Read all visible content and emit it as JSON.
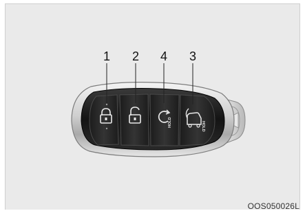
{
  "figure": {
    "image_code": "OOS050026L",
    "background_color": "#eaeaea"
  },
  "callouts": [
    {
      "label": "1",
      "button": "lock"
    },
    {
      "label": "2",
      "button": "unlock"
    },
    {
      "label": "4",
      "button": "remote-start"
    },
    {
      "label": "3",
      "button": "liftgate"
    }
  ],
  "fob_buttons": [
    {
      "function": "lock",
      "icon": "lock-icon"
    },
    {
      "function": "unlock",
      "icon": "unlock-icon"
    },
    {
      "function": "remote-start",
      "icon": "remote-start-icon",
      "text": "HOLD"
    },
    {
      "function": "liftgate",
      "icon": "tailgate-car-icon",
      "text": "HOLD"
    }
  ],
  "colors": {
    "fob_body": "#1a1a1a",
    "chrome": "#d9d9d9",
    "button_face": "#2b2b2b"
  }
}
